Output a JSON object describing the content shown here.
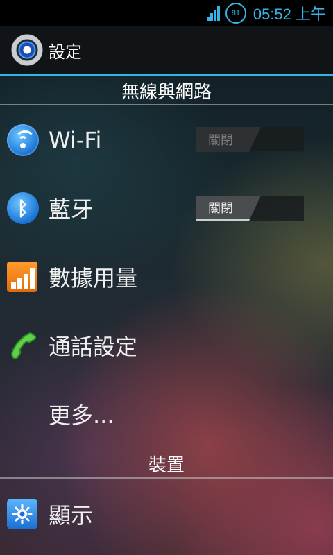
{
  "status_bar": {
    "battery": "81",
    "time": "05:52 上午"
  },
  "action_bar": {
    "icon": "settings-gear-icon",
    "title": "設定"
  },
  "sections": [
    {
      "header": "無線與網路",
      "items": [
        {
          "label": "Wi-Fi",
          "icon": "wifi-icon",
          "toggle": "關閉",
          "toggle_enabled": false
        },
        {
          "label": "藍牙",
          "icon": "bluetooth-icon",
          "toggle": "關閉",
          "toggle_enabled": true
        },
        {
          "label": "數據用量",
          "icon": "data-usage-icon"
        },
        {
          "label": "通話設定",
          "icon": "phone-icon"
        },
        {
          "label": "更多..."
        }
      ]
    },
    {
      "header": "裝置",
      "items": [
        {
          "label": "顯示",
          "icon": "display-icon"
        }
      ]
    }
  ]
}
